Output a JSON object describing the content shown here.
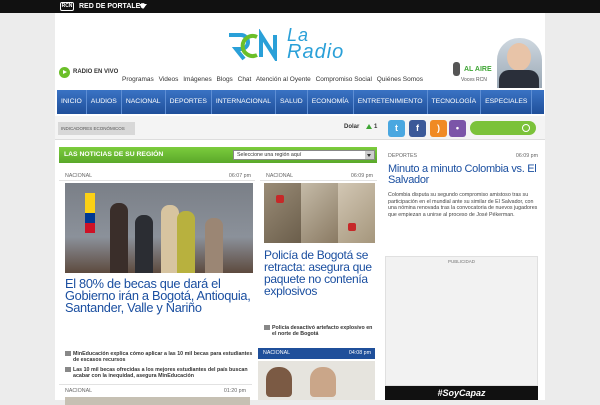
{
  "topbar": {
    "logo": "RCN",
    "network_label": "RED DE PORTALES"
  },
  "header": {
    "logo_la": "La",
    "logo_radio": "Radio",
    "live_label": "RADIO EN VIVO",
    "nav_links": [
      "Programas",
      "Videos",
      "Imágenes",
      "Blogs",
      "Chat",
      "Atención al Oyente",
      "Compromiso Social",
      "Quiénes Somos"
    ],
    "on_air_label": "AL AIRE",
    "on_air_sub": "Voces RCN"
  },
  "main_nav": [
    "INICIO",
    "AUDIOS",
    "NACIONAL",
    "DEPORTES",
    "INTERNACIONAL",
    "SALUD",
    "ECONOMÍA",
    "ENTRETENIMIENTO",
    "TECNOLOGÍA",
    "ESPECIALES"
  ],
  "subbar": {
    "indicators": "INDICADORES ECONÓMICOS",
    "dolar_label": "Dolar",
    "dolar_value": "1"
  },
  "region": {
    "title": "LAS NOTICIAS DE SU REGIÓN",
    "select_value": "Seleccione una región aquí"
  },
  "story1": {
    "category": "NACIONAL",
    "time": "06:07 pm",
    "headline": "El 80% de becas que dará el Gobierno irán a Bogotá, Antioquia, Santander, Valle y Nariño",
    "related": [
      "MinEducación explica cómo aplicar a las 10 mil becas para estudiantes de escasos recursos",
      "Las 10 mil becas ofrecidas a los mejores estudiantes del país buscan acabar con la inequidad, asegura MinEducación"
    ]
  },
  "story2": {
    "category": "NACIONAL",
    "time": "06:09 pm",
    "headline": "Policía de Bogotá se retracta: asegura que paquete no contenía explosivos",
    "related": [
      "Policía desactivó artefacto explosivo en el norte de Bogotá"
    ]
  },
  "story3": {
    "category": "NACIONAL",
    "time": "04:08 pm"
  },
  "story4": {
    "category": "NACIONAL",
    "time": "01:20 pm"
  },
  "sports": {
    "category": "DEPORTES",
    "time": "06:09 pm",
    "headline": "Minuto a minuto Colombia vs. El Salvador",
    "body": "Colombia disputa su segundo compromiso amistoso tras su participación en el mundial ante su similar de El Salvador, con una nómina renovada tras la convocatoria de nuevos jugadores que empiezan a unirse al proceso de José Pékerman."
  },
  "ad": {
    "label": "PUBLICIDAD",
    "banner": "#SoyCapaz"
  },
  "colors": {
    "nav_blue": "#1f4f9a",
    "accent_green": "#6bbf29",
    "headline_blue": "#1b4fa0"
  }
}
